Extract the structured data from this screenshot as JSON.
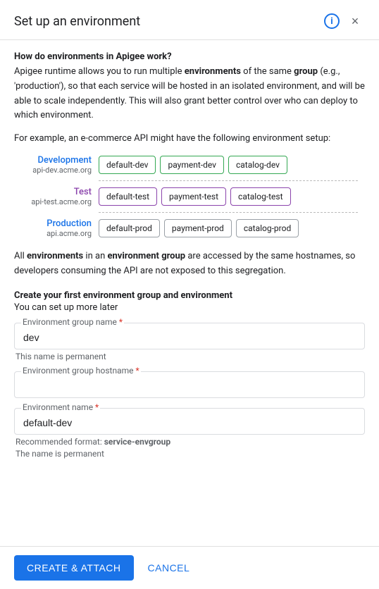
{
  "dialog": {
    "title": "Set up an environment",
    "info_icon_label": "i",
    "close_icon_label": "×"
  },
  "content": {
    "question": "How do environments in Apigee work?",
    "description_1": "Apigee runtime allows you to run multiple environments of the same group (e.g., 'production'), so that each service will be hosted in an isolated environment, and will be able to scale independently. This will also grant better control over who can deploy to which environment.",
    "description_2": "For example, an e-commerce API might have the following environment setup:",
    "diagram": {
      "rows": [
        {
          "label_name": "Development",
          "label_color": "blue",
          "label_url": "api-dev.acme.org",
          "boxes": [
            "default-dev",
            "payment-dev",
            "catalog-dev"
          ],
          "box_style": "green"
        },
        {
          "label_name": "Test",
          "label_color": "purple",
          "label_url": "api-test.acme.org",
          "boxes": [
            "default-test",
            "payment-test",
            "catalog-test"
          ],
          "box_style": "purple"
        },
        {
          "label_name": "Production",
          "label_color": "blue",
          "label_url": "api.acme.org",
          "boxes": [
            "default-prod",
            "payment-prod",
            "catalog-prod"
          ],
          "box_style": "gray"
        }
      ]
    },
    "access_text_1": "All environments in an environment group are accessed by the same hostnames, so developers consuming the API are not exposed to this segregation.",
    "create_title": "Create your first environment group and environment",
    "create_sub": "You can set up more later",
    "fields": [
      {
        "label": "Environment group name",
        "required": true,
        "value": "dev",
        "hint": "This name is permanent",
        "hint_bold": false,
        "placeholder": ""
      },
      {
        "label": "Environment group hostname",
        "required": true,
        "value": "",
        "hint": "",
        "hint_bold": false,
        "placeholder": ""
      },
      {
        "label": "Environment name",
        "required": true,
        "value": "default-dev",
        "hint_line1": "Recommended format: service-envgroup",
        "hint_line2": "The name is permanent",
        "hint_bold": true,
        "placeholder": ""
      }
    ]
  },
  "footer": {
    "create_label": "CREATE & ATTACH",
    "cancel_label": "CANCEL"
  }
}
